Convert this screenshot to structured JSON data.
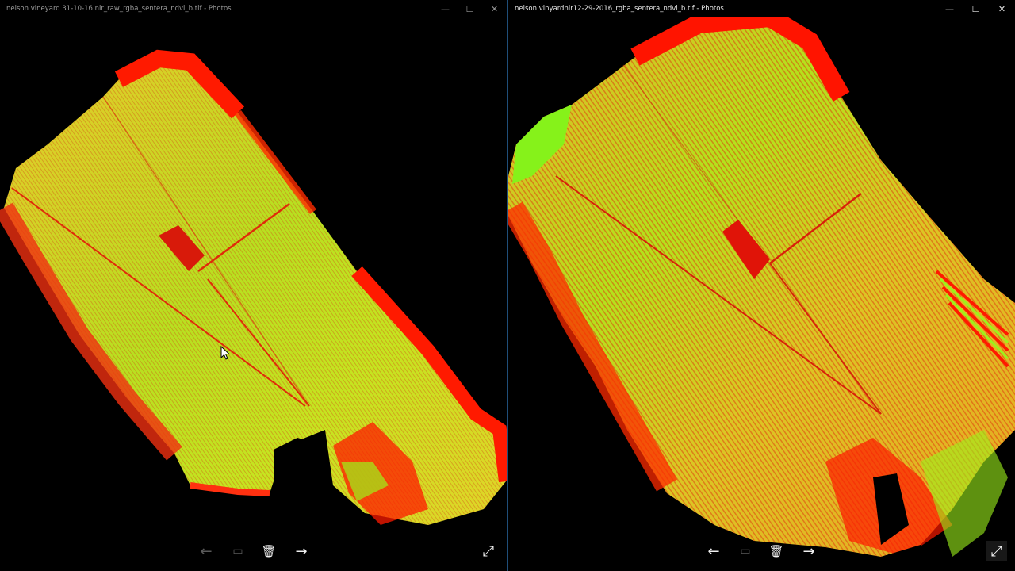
{
  "windows": {
    "left": {
      "title": "nelson vineyard 31-10-16 nir_raw_rgba_sentera_ndvi_b.tif - Photos",
      "controls": {
        "minimize": "—",
        "maximize": "☐",
        "close": "✕"
      },
      "toolbar": {
        "prev": "←",
        "slideshow": "▭",
        "delete": "🗑",
        "next": "→",
        "fullscreen": "⤢"
      }
    },
    "right": {
      "title": "nelson vinyardnir12-29-2016_rgba_sentera_ndvi_b.tif - Photos",
      "controls": {
        "minimize": "—",
        "maximize": "☐",
        "close": "✕"
      },
      "toolbar": {
        "prev": "←",
        "slideshow": "▭",
        "delete": "🗑",
        "next": "→",
        "fullscreen": "⤢"
      }
    }
  },
  "colors": {
    "ndvi_low": "#ff0000",
    "ndvi_mid": "#e8d82a",
    "ndvi_high": "#9df21a",
    "background": "#000000",
    "active_border": "#1f4e79"
  }
}
